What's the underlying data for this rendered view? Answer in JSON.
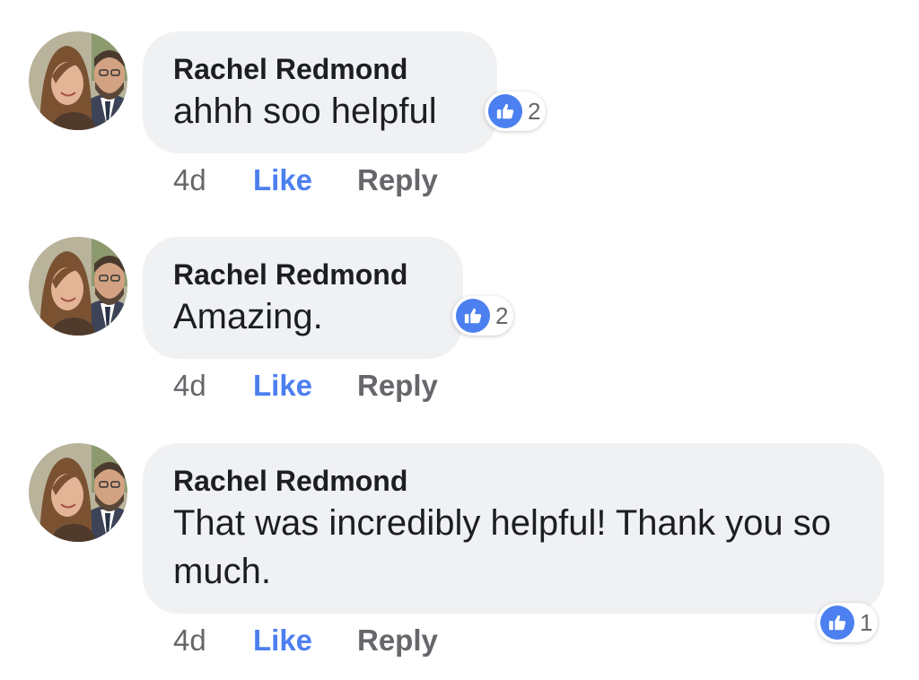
{
  "comments": [
    {
      "author": "Rachel Redmond",
      "text": "ahhh soo helpful",
      "reactions": {
        "icon": "thumbs-up-icon",
        "count": "2"
      },
      "time": "4d",
      "like_label": "Like",
      "reply_label": "Reply"
    },
    {
      "author": "Rachel Redmond",
      "text": "Amazing.",
      "reactions": {
        "icon": "thumbs-up-icon",
        "count": "2"
      },
      "time": "4d",
      "like_label": "Like",
      "reply_label": "Reply"
    },
    {
      "author": "Rachel Redmond",
      "text": "That was incredibly helpful! Thank you so much.",
      "reactions": {
        "icon": "thumbs-up-icon",
        "count": "1"
      },
      "time": "4d",
      "like_label": "Like",
      "reply_label": "Reply"
    }
  ],
  "colors": {
    "bubble_background": "#f0f1f3",
    "like_blue": "#4c7ff0",
    "secondary_text": "#65676b",
    "primary_text": "#1c1e21"
  }
}
